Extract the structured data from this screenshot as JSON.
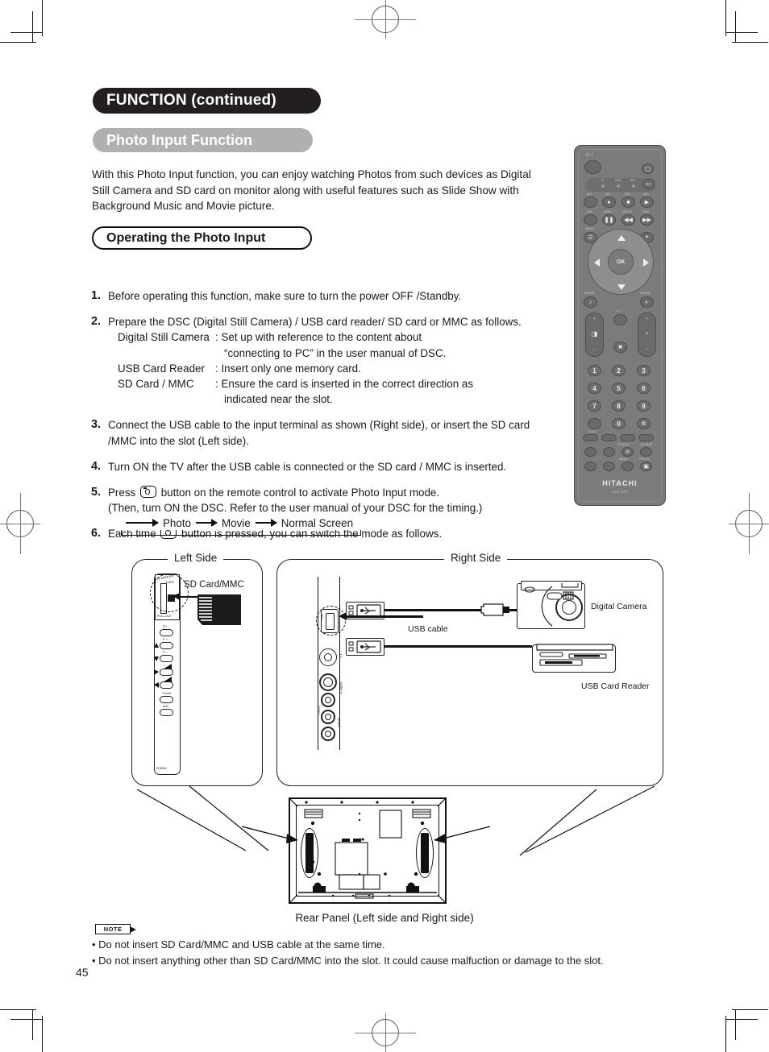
{
  "header": {
    "title": "FUNCTION (continued)",
    "subtitle": "Photo Input Function"
  },
  "intro": "With this Photo Input function, you can enjoy watching Photos from such devices as Digital Still Camera and SD card on monitor along with useful features such as Slide Show with Background Music and Movie picture.",
  "section": {
    "title": "Operating the Photo Input"
  },
  "steps": [
    {
      "num": "1.",
      "text": "Before operating this function, make sure to turn the power OFF /Standby."
    },
    {
      "num": "2.",
      "text": "Prepare the DSC (Digital Still Camera) / USB card reader/ SD card or MMC as follows.",
      "rows": [
        {
          "key": "Digital Still Camera",
          "value": ": Set up with reference to the content about"
        },
        {
          "key": "",
          "value": "“connecting to PC” in the user manual of DSC."
        },
        {
          "key": "USB Card Reader",
          "value": ": Insert only one memory card."
        },
        {
          "key": "SD Card / MMC",
          "value": ": Ensure the card is inserted in the correct direction as"
        },
        {
          "key": "",
          "value": "indicated near the slot."
        }
      ]
    },
    {
      "num": "3.",
      "text": "Connect the USB cable to the input terminal as shown (Right side), or insert the SD card /MMC into the slot (Left side)."
    },
    {
      "num": "4.",
      "text": "Turn ON the TV after the USB cable is connected or the SD card / MMC is inserted."
    },
    {
      "num": "5.",
      "before": "Press",
      "after": "button on the remote control to activate Photo Input mode.",
      "line2": "(Then, turn ON the DSC. Refer to the user manual of your DSC for the timing.)"
    },
    {
      "num": "6.",
      "before": "Each time",
      "after": "button is pressed, you can switch the mode as follows."
    }
  ],
  "flow": {
    "items": [
      "Photo",
      "Movie",
      "Normal Screen"
    ]
  },
  "remote": {
    "brand": "HITACHI",
    "model": "CLE-973",
    "source_labels": [
      "TV",
      "DVD",
      "SAT"
    ],
    "set_label": "SET",
    "row_labels_1": [
      "AV1",
      "AV2",
      "AV3",
      "AV4"
    ],
    "row_labels_2": [
      "AV5",
      "HDMI 1",
      "HDMI 2",
      "RGB"
    ],
    "menu_label": "MENU",
    "ok_label": "OK",
    "smode_label": "S.MODE",
    "pmode_label": "P.MODE",
    "ratio_label": "1:1",
    "numbers": [
      "1",
      "2",
      "3",
      "4",
      "5",
      "6",
      "7",
      "8",
      "9",
      "0"
    ],
    "d_label": "D-4:3",
    "bottom_left_label": "D.ZOOM",
    "bottom_right_label": "ROTATE",
    "smallz_label": "SMALL",
    "photo_label": "PHOTO"
  },
  "diagram": {
    "left_side_label": "Left Side",
    "right_side_label": "Right Side",
    "sd_card_label": "SD Card/MMC",
    "digital_camera_label": "Digital Camera",
    "usb_cable_label": "USB cable",
    "usb_card_reader_label": "USB Card Reader",
    "rear_caption": "Rear Panel (Left side and Right side)",
    "slot_text_top": "SD MEMORY",
    "slot_text_card": "CARD",
    "slot_text_bottom": "PULL-OUT",
    "panel_model": "PH8084",
    "side_buttons": [
      {
        "label": "⏻ I"
      },
      {
        "label": "P +"
      },
      {
        "label": "P −"
      },
      {
        "label": "+"
      },
      {
        "label": "−"
      },
      {
        "label": "TV/AV"
      },
      {
        "label": "S/N"
      }
    ],
    "right_port_labels": [
      "USB",
      "VIDEO",
      "S-VIDEO",
      "AUDIO",
      "R",
      "L"
    ]
  },
  "note": {
    "badge": "NOTE",
    "lines": [
      "• Do not insert SD Card/MMC and USB cable at the same time.",
      "• Do not insert anything other than SD Card/MMC into the slot. It could cause malfuction or damage to the slot."
    ]
  },
  "page_number": "45",
  "colors": {
    "header_bg": "#231f20",
    "subheader_bg": "#b0b0b0",
    "remote_body": "#7b7b7b",
    "ink": "#1a1a1a"
  }
}
